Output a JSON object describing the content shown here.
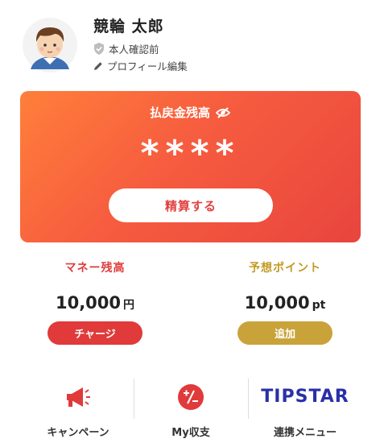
{
  "profile": {
    "name": "競輪 太郎",
    "verification_status": "本人確認前",
    "edit_profile_label": "プロフィール編集"
  },
  "balance_card": {
    "title": "払戻金残高",
    "masked_value": "****",
    "settle_button": "精算する",
    "visibility_icon": "eye-slash-icon"
  },
  "money": {
    "label": "マネー残高",
    "amount": "10,000",
    "unit": "円",
    "button": "チャージ"
  },
  "points": {
    "label": "予想ポイント",
    "amount": "10,000",
    "unit": "pt",
    "button": "追加"
  },
  "bottom_menu": [
    {
      "label": "キャンペーン",
      "icon": "megaphone-icon"
    },
    {
      "label": "My収支",
      "icon": "plus-minus-icon"
    },
    {
      "label": "連携メニュー",
      "icon": "tipstar-logo",
      "logo_text": "TIPSTAR"
    }
  ],
  "colors": {
    "card_gradient_start": "#ff7f3a",
    "card_gradient_end": "#e8453e",
    "money_red": "#e03a3a",
    "points_gold": "#c9a33a",
    "tipstar_blue": "#2a2fa8"
  }
}
